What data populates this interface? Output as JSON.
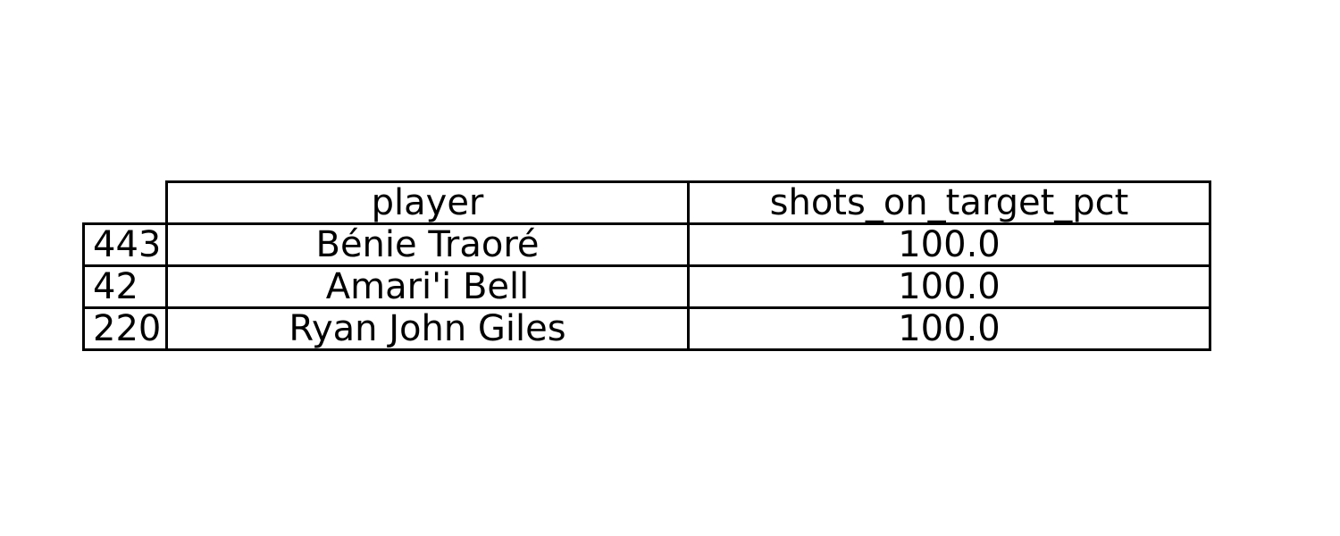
{
  "chart_data": {
    "type": "table",
    "columns": [
      "player",
      "shots_on_target_pct"
    ],
    "rows": [
      {
        "index": "443",
        "player": "Bénie Traoré",
        "shots_on_target_pct": "100.0"
      },
      {
        "index": "42",
        "player": "Amari'i Bell",
        "shots_on_target_pct": "100.0"
      },
      {
        "index": "220",
        "player": "Ryan John Giles",
        "shots_on_target_pct": "100.0"
      }
    ]
  }
}
